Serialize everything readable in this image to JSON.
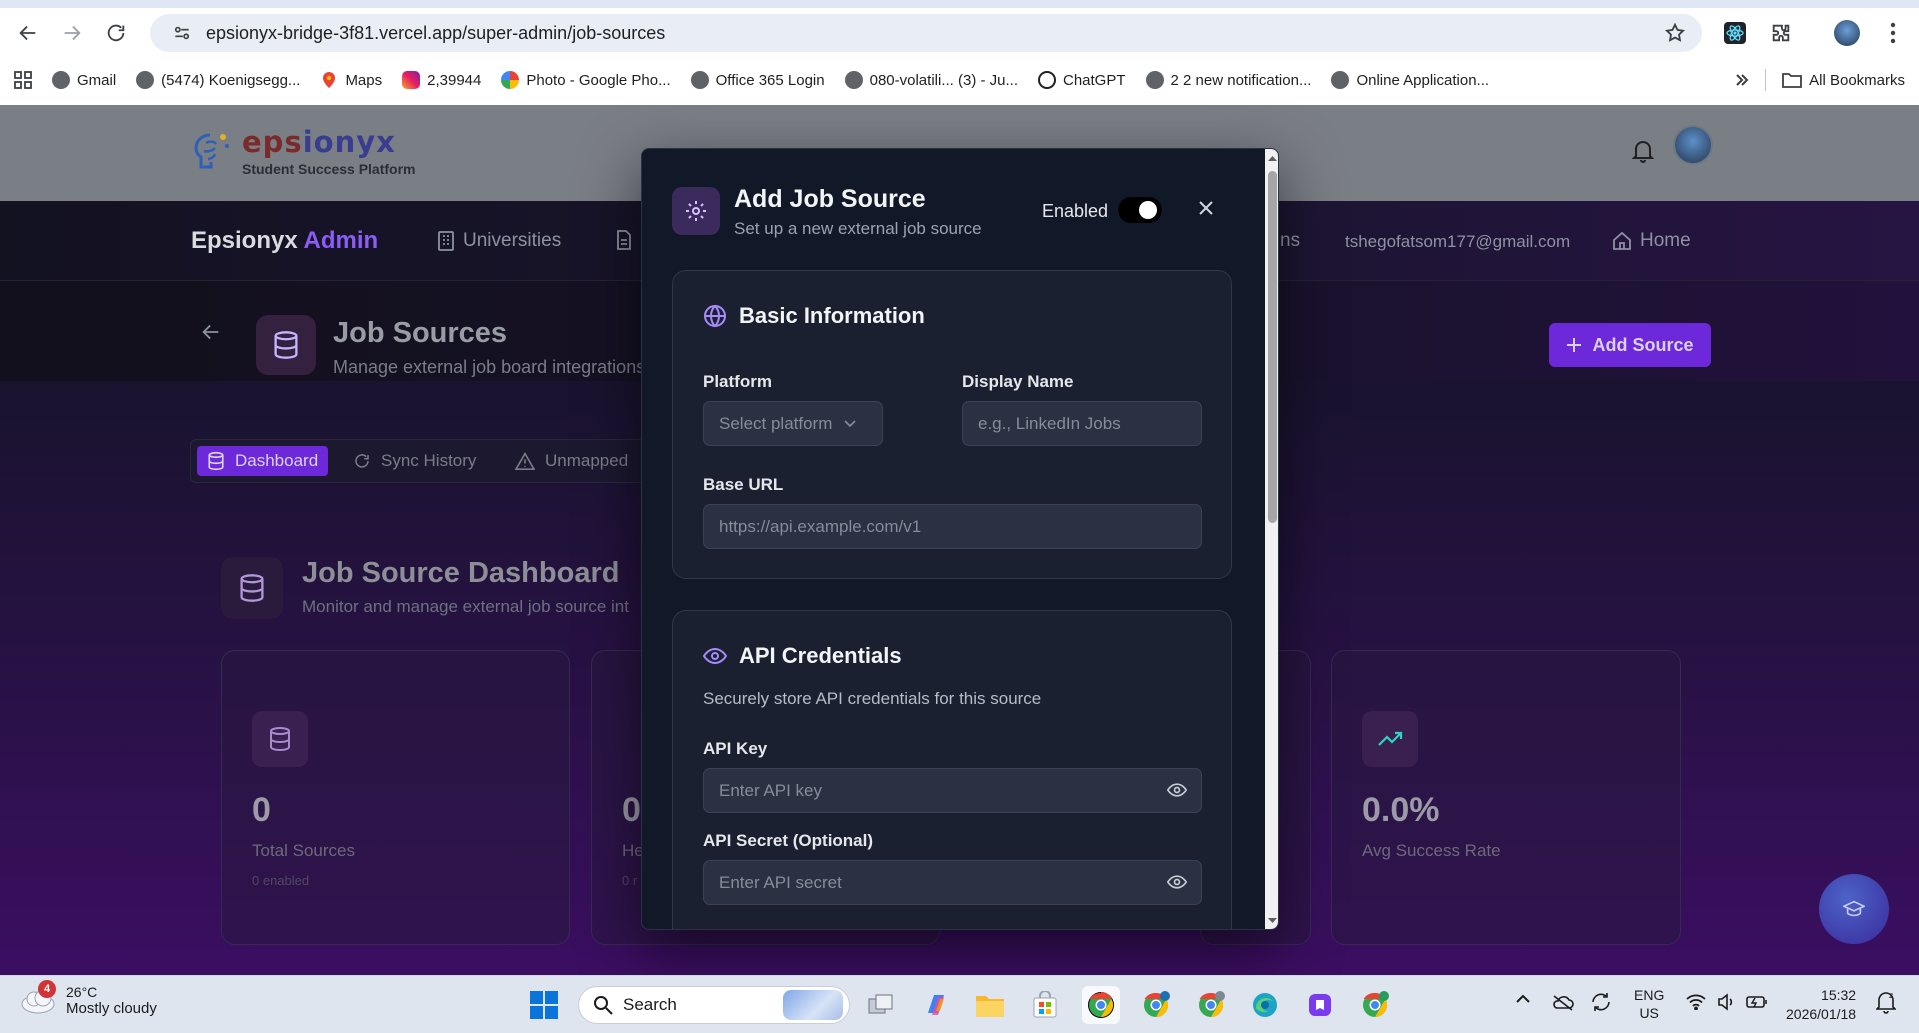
{
  "browser": {
    "url": "epsionyx-bridge-3f81.vercel.app/super-admin/job-sources",
    "bookmarks": [
      {
        "label": "Gmail"
      },
      {
        "label": "(5474) Koenigsegg..."
      },
      {
        "label": "Maps"
      },
      {
        "label": "2,39944"
      },
      {
        "label": "Photo - Google Pho..."
      },
      {
        "label": "Office 365 Login"
      },
      {
        "label": "080-volatili... (3) - Ju..."
      },
      {
        "label": "ChatGPT"
      },
      {
        "label": "2 2 new notification..."
      },
      {
        "label": "Online Application..."
      }
    ],
    "all_bookmarks": "All Bookmarks"
  },
  "app": {
    "logo_name_part1": "eps",
    "logo_name_part2": "ionyx",
    "logo_sub": "Student Success Platform",
    "brand_part1": "Epsionyx ",
    "brand_part2": "Admin",
    "nav": {
      "universities": "Universities",
      "ns_fragment": "ns",
      "email": "tshegofatsom177@gmail.com",
      "home": "Home"
    },
    "page_title": "Job Sources",
    "page_sub": "Manage external job board integrations",
    "add_source": "Add Source",
    "tabs": {
      "dashboard": "Dashboard",
      "sync_history": "Sync History",
      "unmapped": "Unmapped"
    },
    "dashboard_title": "Job Source Dashboard",
    "dashboard_sub": "Monitor and manage external job source int",
    "stats": [
      {
        "value": "0",
        "label": "Total Sources",
        "meta": "0 enabled"
      },
      {
        "value": "0",
        "label": "He",
        "meta": "0 r"
      },
      {
        "value": "0.0%",
        "label": "Avg Success Rate",
        "meta": ""
      }
    ]
  },
  "modal": {
    "title": "Add Job Source",
    "subtitle": "Set up a new external job source",
    "enabled_label": "Enabled",
    "enabled": true,
    "basic": {
      "title": "Basic Information",
      "platform_label": "Platform",
      "platform_value": "Select platform",
      "display_name_label": "Display Name",
      "display_name_placeholder": "e.g., LinkedIn Jobs",
      "base_url_label": "Base URL",
      "base_url_placeholder": "https://api.example.com/v1"
    },
    "api": {
      "title": "API Credentials",
      "desc": "Securely store API credentials for this source",
      "key_label": "API Key",
      "key_placeholder": "Enter API key",
      "secret_label": "API Secret (Optional)",
      "secret_placeholder": "Enter API secret"
    }
  },
  "taskbar": {
    "weather_badge": "4",
    "temp": "26°C",
    "condition": "Mostly cloudy",
    "search": "Search",
    "lang1": "ENG",
    "lang2": "US",
    "time": "15:32",
    "date": "2026/01/18"
  },
  "colors": {
    "accent": "#6d28d9",
    "brand_purple": "#8b5cf6",
    "modal_bg": "#111827"
  }
}
